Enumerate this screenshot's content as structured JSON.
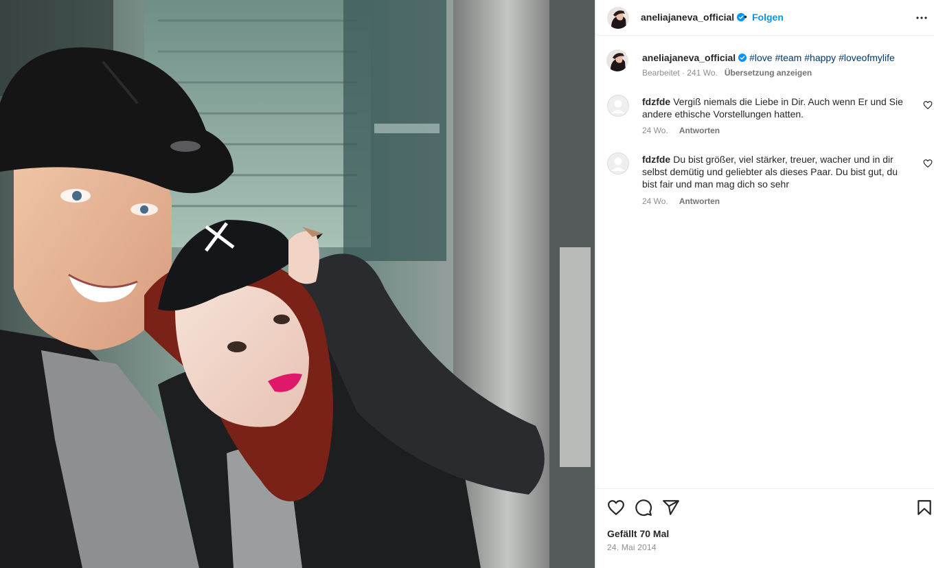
{
  "post": {
    "author": "aneliajaneva_official",
    "follow_label": "Folgen",
    "separator": "•",
    "caption": {
      "username": "aneliajaneva_official",
      "hashtags": [
        "#love",
        "#team",
        "#happy",
        "#loveofmylife"
      ],
      "edited": "Bearbeitet · 241 Wo.",
      "translate": "Übersetzung anzeigen"
    },
    "comments": [
      {
        "username": "fdzfde",
        "text": "Vergiß niemals die Liebe in Dir. Auch wenn Er und Sie andere ethische Vorstellungen hatten.",
        "age": "24 Wo.",
        "reply": "Antworten"
      },
      {
        "username": "fdzfde",
        "text": "Du bist größer, viel stärker, treuer, wacher und in dir selbst demütig und geliebter als dieses Paar. Du bist gut, du bist fair und man mag dich so sehr",
        "age": "24 Wo.",
        "reply": "Antworten"
      }
    ],
    "likes": "Gefällt 70 Mal",
    "date": "24. Mai 2014"
  },
  "colors": {
    "accent": "#0095f6",
    "verified": "#0095f6",
    "hashtag": "#00376b",
    "muted": "#8e8e8e"
  },
  "icons": {
    "like": "heart-icon",
    "comment": "comment-bubble-icon",
    "share": "paper-plane-icon",
    "save": "bookmark-icon",
    "more": "ellipsis-icon",
    "verified": "verified-badge-icon"
  }
}
